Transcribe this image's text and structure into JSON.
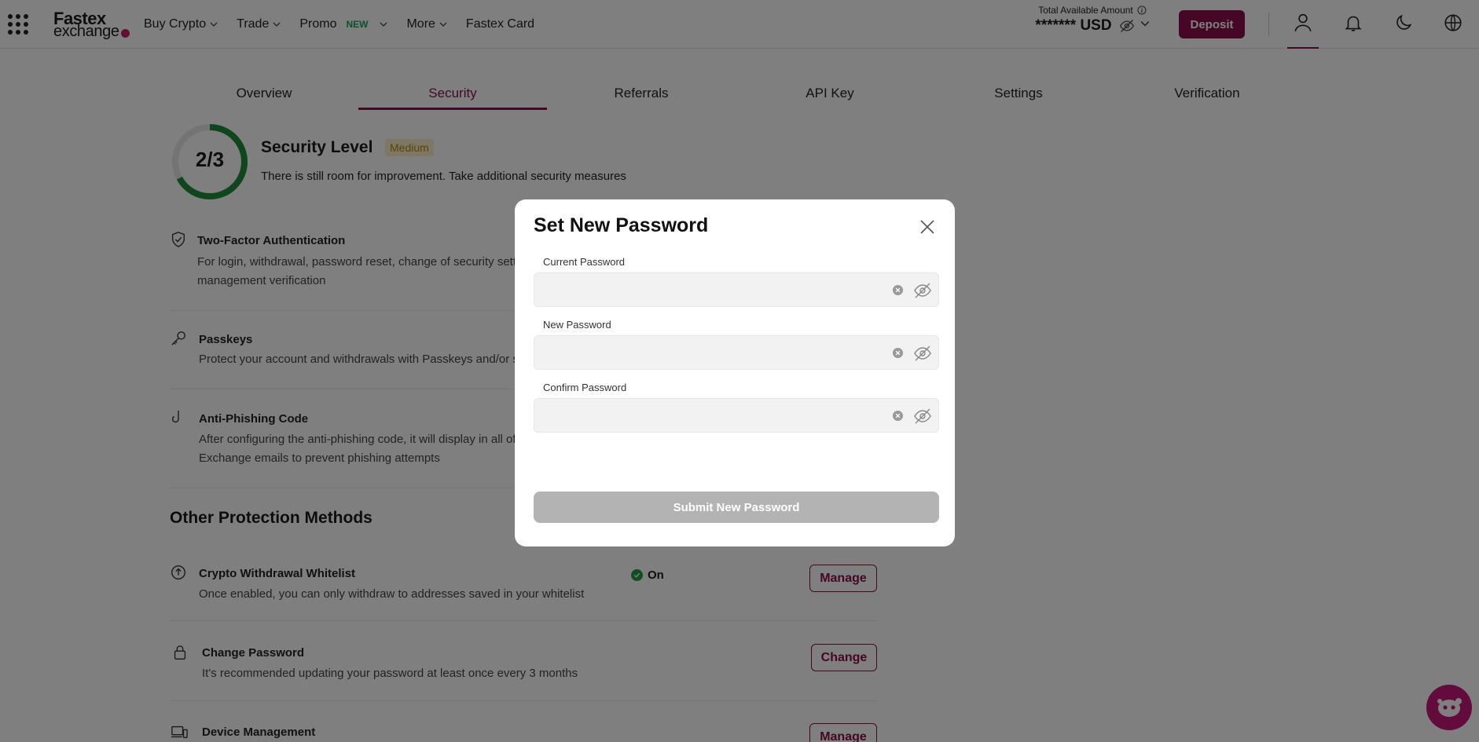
{
  "header": {
    "logo_top": "Fastex",
    "logo_bottom": "exchange",
    "nav": [
      {
        "label": "Buy Crypto"
      },
      {
        "label": "Trade"
      },
      {
        "label": "Promo",
        "badge": "NEW"
      },
      {
        "label": "More"
      },
      {
        "label": "Fastex Card"
      }
    ],
    "available_label": "Total Available Amount",
    "available_value": "******* USD",
    "deposit": "Deposit"
  },
  "tabs": [
    "Overview",
    "Security",
    "Referrals",
    "API Key",
    "Settings",
    "Verification"
  ],
  "active_tab": "Security",
  "security": {
    "score": "2/3",
    "score_fraction": 0.67,
    "title": "Security Level",
    "level": "Medium",
    "description": "There is still room for improvement. Take additional security measures"
  },
  "items": [
    {
      "title": "Two-Factor Authentication",
      "desc_line1": "For login, withdrawal, password reset, change of security settings and API",
      "desc_line2": "management verification"
    },
    {
      "title": "Passkeys",
      "desc_line1": "Protect your account and withdrawals with Passkeys and/or security keys"
    },
    {
      "title": "Anti-Phishing Code",
      "desc_line1": "After configuring the anti-phishing code, it will display in all official Fastex",
      "desc_line2": "Exchange emails to prevent phishing attempts"
    }
  ],
  "other": {
    "section_title": "Other Protection Methods",
    "whitelist": {
      "title": "Crypto Withdrawal Whitelist",
      "desc": "Once enabled, you can only withdraw to addresses saved in your whitelist",
      "status": "On",
      "button": "Manage"
    },
    "password": {
      "title": "Change Password",
      "desc": "It's recommended updating your password at least once every 3 months",
      "button": "Change"
    },
    "device": {
      "title": "Device Management",
      "button": "Manage"
    }
  },
  "modal": {
    "title": "Set New Password",
    "fields": [
      {
        "label": "Current Password",
        "value": ""
      },
      {
        "label": "New Password",
        "value": ""
      },
      {
        "label": "Confirm Password",
        "value": ""
      }
    ],
    "submit": "Submit New Password"
  },
  "colors": {
    "brand": "#8a0f4b",
    "chat": "#c8177a",
    "ring": "#1e8c3a",
    "badge_bg": "#fbf0cc"
  }
}
